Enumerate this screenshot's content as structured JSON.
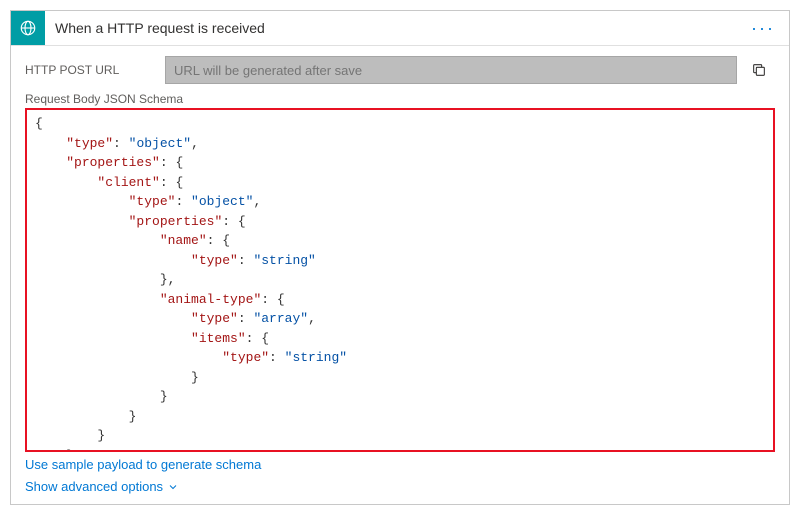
{
  "header": {
    "title": "When a HTTP request is received",
    "icon": "http-trigger-icon",
    "more_label": "···"
  },
  "url_row": {
    "label": "HTTP POST URL",
    "placeholder": "URL will be generated after save"
  },
  "schema": {
    "label": "Request Body JSON Schema",
    "content": {
      "type": "object",
      "properties": {
        "client": {
          "type": "object",
          "properties": {
            "name": {
              "type": "string"
            },
            "animal-type": {
              "type": "array",
              "items": {
                "type": "string"
              }
            }
          }
        }
      }
    },
    "tokens": [
      {
        "t": "brace",
        "v": "{"
      },
      {
        "t": "nl"
      },
      {
        "t": "ind",
        "n": 1
      },
      {
        "t": "key",
        "v": "\"type\""
      },
      {
        "t": "plain",
        "v": ": "
      },
      {
        "t": "str",
        "v": "\"object\""
      },
      {
        "t": "plain",
        "v": ","
      },
      {
        "t": "nl"
      },
      {
        "t": "ind",
        "n": 1
      },
      {
        "t": "key",
        "v": "\"properties\""
      },
      {
        "t": "plain",
        "v": ": "
      },
      {
        "t": "brace",
        "v": "{"
      },
      {
        "t": "nl"
      },
      {
        "t": "ind",
        "n": 2
      },
      {
        "t": "key",
        "v": "\"client\""
      },
      {
        "t": "plain",
        "v": ": "
      },
      {
        "t": "brace",
        "v": "{"
      },
      {
        "t": "nl"
      },
      {
        "t": "ind",
        "n": 3
      },
      {
        "t": "key",
        "v": "\"type\""
      },
      {
        "t": "plain",
        "v": ": "
      },
      {
        "t": "str",
        "v": "\"object\""
      },
      {
        "t": "plain",
        "v": ","
      },
      {
        "t": "nl"
      },
      {
        "t": "ind",
        "n": 3
      },
      {
        "t": "key",
        "v": "\"properties\""
      },
      {
        "t": "plain",
        "v": ": "
      },
      {
        "t": "brace",
        "v": "{"
      },
      {
        "t": "nl"
      },
      {
        "t": "ind",
        "n": 4
      },
      {
        "t": "key",
        "v": "\"name\""
      },
      {
        "t": "plain",
        "v": ": "
      },
      {
        "t": "brace",
        "v": "{"
      },
      {
        "t": "nl"
      },
      {
        "t": "ind",
        "n": 5
      },
      {
        "t": "key",
        "v": "\"type\""
      },
      {
        "t": "plain",
        "v": ": "
      },
      {
        "t": "str",
        "v": "\"string\""
      },
      {
        "t": "nl"
      },
      {
        "t": "ind",
        "n": 4
      },
      {
        "t": "brace",
        "v": "}"
      },
      {
        "t": "plain",
        "v": ","
      },
      {
        "t": "nl"
      },
      {
        "t": "ind",
        "n": 4
      },
      {
        "t": "key",
        "v": "\"animal-type\""
      },
      {
        "t": "plain",
        "v": ": "
      },
      {
        "t": "brace",
        "v": "{"
      },
      {
        "t": "nl"
      },
      {
        "t": "ind",
        "n": 5
      },
      {
        "t": "key",
        "v": "\"type\""
      },
      {
        "t": "plain",
        "v": ": "
      },
      {
        "t": "str",
        "v": "\"array\""
      },
      {
        "t": "plain",
        "v": ","
      },
      {
        "t": "nl"
      },
      {
        "t": "ind",
        "n": 5
      },
      {
        "t": "key",
        "v": "\"items\""
      },
      {
        "t": "plain",
        "v": ": "
      },
      {
        "t": "brace",
        "v": "{"
      },
      {
        "t": "nl"
      },
      {
        "t": "ind",
        "n": 6
      },
      {
        "t": "key",
        "v": "\"type\""
      },
      {
        "t": "plain",
        "v": ": "
      },
      {
        "t": "str",
        "v": "\"string\""
      },
      {
        "t": "nl"
      },
      {
        "t": "ind",
        "n": 5
      },
      {
        "t": "brace",
        "v": "}"
      },
      {
        "t": "nl"
      },
      {
        "t": "ind",
        "n": 4
      },
      {
        "t": "brace",
        "v": "}"
      },
      {
        "t": "nl"
      },
      {
        "t": "ind",
        "n": 3
      },
      {
        "t": "brace",
        "v": "}"
      },
      {
        "t": "nl"
      },
      {
        "t": "ind",
        "n": 2
      },
      {
        "t": "brace",
        "v": "}"
      },
      {
        "t": "nl"
      },
      {
        "t": "ind",
        "n": 1
      },
      {
        "t": "brace",
        "v": "}"
      },
      {
        "t": "nl"
      },
      {
        "t": "brace",
        "v": "}"
      }
    ]
  },
  "links": {
    "sample_payload": "Use sample payload to generate schema",
    "advanced": "Show advanced options"
  },
  "colors": {
    "accent": "#009da5",
    "link": "#0078d4",
    "highlight_border": "#e81123"
  }
}
